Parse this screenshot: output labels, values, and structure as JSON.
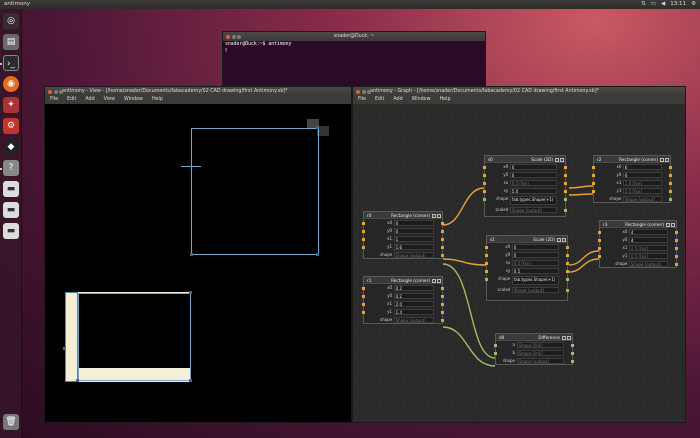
{
  "top_panel": {
    "app_title": "antimony",
    "clock": "13:11"
  },
  "terminal": {
    "title": "snader@Duck: ~",
    "prompt": "snader@Duck:~$ antimony"
  },
  "view_window": {
    "title": "antimony - View - [/home/snader/Documents/fabacademy/02 CAD drawing/first Antimony.sb]*",
    "menu": [
      "File",
      "Edit",
      "Add",
      "View",
      "Window",
      "Help"
    ]
  },
  "graph_window": {
    "title": "antimony - Graph - [/home/snader/Documents/fabacademy/02 CAD drawing/first Antimony.sb]*",
    "menu": [
      "File",
      "Edit",
      "Add",
      "Window",
      "Help"
    ]
  },
  "nodes": {
    "s0": {
      "name": "s0",
      "type": "Scale (2D)",
      "rows": [
        {
          "label": "x0",
          "value": "0"
        },
        {
          "label": "y0",
          "value": "0"
        },
        {
          "label": "sx",
          "value": "0.5 [fxn]"
        },
        {
          "label": "sy",
          "value": "5.0"
        },
        {
          "label": "shape",
          "value": "fab.types.Shape(+1)"
        },
        {
          "label": "scaled",
          "value": "Shape [output]"
        }
      ]
    },
    "r2": {
      "name": "r2",
      "type": "Rectangle (corner)",
      "rows": [
        {
          "label": "x0",
          "value": "6"
        },
        {
          "label": "y0",
          "value": "6"
        },
        {
          "label": "x1",
          "value": "1.0 [fxn]"
        },
        {
          "label": "y1",
          "value": "0.5 [fxn]"
        },
        {
          "label": "shape",
          "value": "Shape [output]"
        }
      ]
    },
    "r0": {
      "name": "r0",
      "type": "Rectangle (corner)",
      "rows": [
        {
          "label": "x0",
          "value": "0"
        },
        {
          "label": "y0",
          "value": "0"
        },
        {
          "label": "x1",
          "value": "1"
        },
        {
          "label": "y1",
          "value": "1.6"
        },
        {
          "label": "shape",
          "value": "Shape [output]"
        }
      ]
    },
    "r3": {
      "name": "r3",
      "type": "Rectangle (corner)",
      "rows": [
        {
          "label": "x0",
          "value": "4"
        },
        {
          "label": "y0",
          "value": "4"
        },
        {
          "label": "x1",
          "value": "2.5 [fxn]"
        },
        {
          "label": "y1",
          "value": "0.5 [fxn]"
        },
        {
          "label": "shape",
          "value": "Shape [output]"
        }
      ]
    },
    "s1": {
      "name": "s1",
      "type": "Scale (2D)",
      "rows": [
        {
          "label": "x0",
          "value": "0"
        },
        {
          "label": "y0",
          "value": "0"
        },
        {
          "label": "sx",
          "value": "0.5 [fxn]"
        },
        {
          "label": "sy",
          "value": "0.5"
        },
        {
          "label": "shape",
          "value": "fab.types.Shape(+1)"
        },
        {
          "label": "scaled",
          "value": "Shape [output]"
        }
      ]
    },
    "r1": {
      "name": "r1",
      "type": "Rectangle (corner)",
      "rows": [
        {
          "label": "x0",
          "value": "0.2"
        },
        {
          "label": "y0",
          "value": "0.2"
        },
        {
          "label": "x1",
          "value": "2.0"
        },
        {
          "label": "y1",
          "value": "1.4"
        },
        {
          "label": "shape",
          "value": "Shape [output]"
        }
      ]
    },
    "d0": {
      "name": "d0",
      "type": "Difference",
      "rows": [
        {
          "label": "a",
          "value": "Shape [link]"
        },
        {
          "label": "b",
          "value": "Shape [link]"
        },
        {
          "label": "shape",
          "value": "Shape [output]"
        }
      ]
    }
  },
  "colors": {
    "num_pin": "#e8a23c",
    "shape_pin": "#9ebd5e",
    "outline": "#7aa4c4",
    "fill_shape": "#f3f0d8",
    "close_button": "#e4613a"
  }
}
